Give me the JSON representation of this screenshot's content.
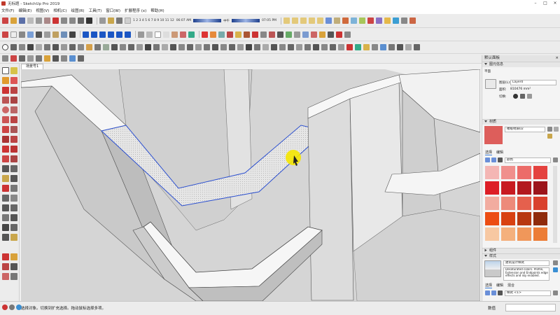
{
  "window": {
    "title": "无标题 - SketchUp Pro 2019",
    "controls": [
      "–",
      "□",
      "×"
    ]
  },
  "menu": [
    "文件(F)",
    "编辑(E)",
    "视图(V)",
    "相机(C)",
    "绘图(R)",
    "工具(T)",
    "窗口(W)",
    "扩展程序 (x)",
    "帮助(H)"
  ],
  "toolbar": {
    "shadow_months": "1 2 3 4 5 6 7 8 9 10 11 12",
    "time_start": "06:07 AM",
    "time_noon": "中午",
    "time_end": "07:05 PM"
  },
  "scene_tab": "场景号1",
  "statusbar": {
    "hint": "选择对象。切换到扩充选择。拖动鼠标选择多项。",
    "value_label": "数值",
    "value": ""
  },
  "tray": {
    "title": "默认面板",
    "close": "×",
    "entity_info": {
      "header": "图元信息",
      "type": "平面",
      "layer_label": "图层(L):",
      "layer_value": "Layer0",
      "area_label": "面积:",
      "area_value": "810476 mm²",
      "toggle_label": "切换:"
    },
    "materials": {
      "header": "材质",
      "material_name": "楼板材质02",
      "tab_select": "选择",
      "tab_edit": "编辑",
      "category": "颜色",
      "swatches": [
        [
          "#f4b6b4",
          "#f08f8c",
          "#ec6c69",
          "#e4423f"
        ],
        [
          "#dd1e26",
          "#c81b21",
          "#b3191e",
          "#9c151b"
        ],
        [
          "#f2aca0",
          "#ed8a7a",
          "#e5604d",
          "#d9412d"
        ],
        [
          "#ec4d13",
          "#d84212",
          "#b8380f",
          "#8f2b0b"
        ],
        [
          "#f7c8a2",
          "#f4b07d",
          "#f0975a",
          "#ec7d36"
        ]
      ],
      "current_color": "#dd5e5b"
    },
    "components": {
      "header": "组件"
    },
    "styles": {
      "header": "样式",
      "style_name": "建筑设计样式",
      "description": "Desaturated colors. Profile, Extension and Endpoints edge effects and sky enabled.",
      "tab_select": "选择",
      "tab_edit": "编辑",
      "tab_mix": "混合",
      "dropdown": "样式 <1>"
    }
  }
}
